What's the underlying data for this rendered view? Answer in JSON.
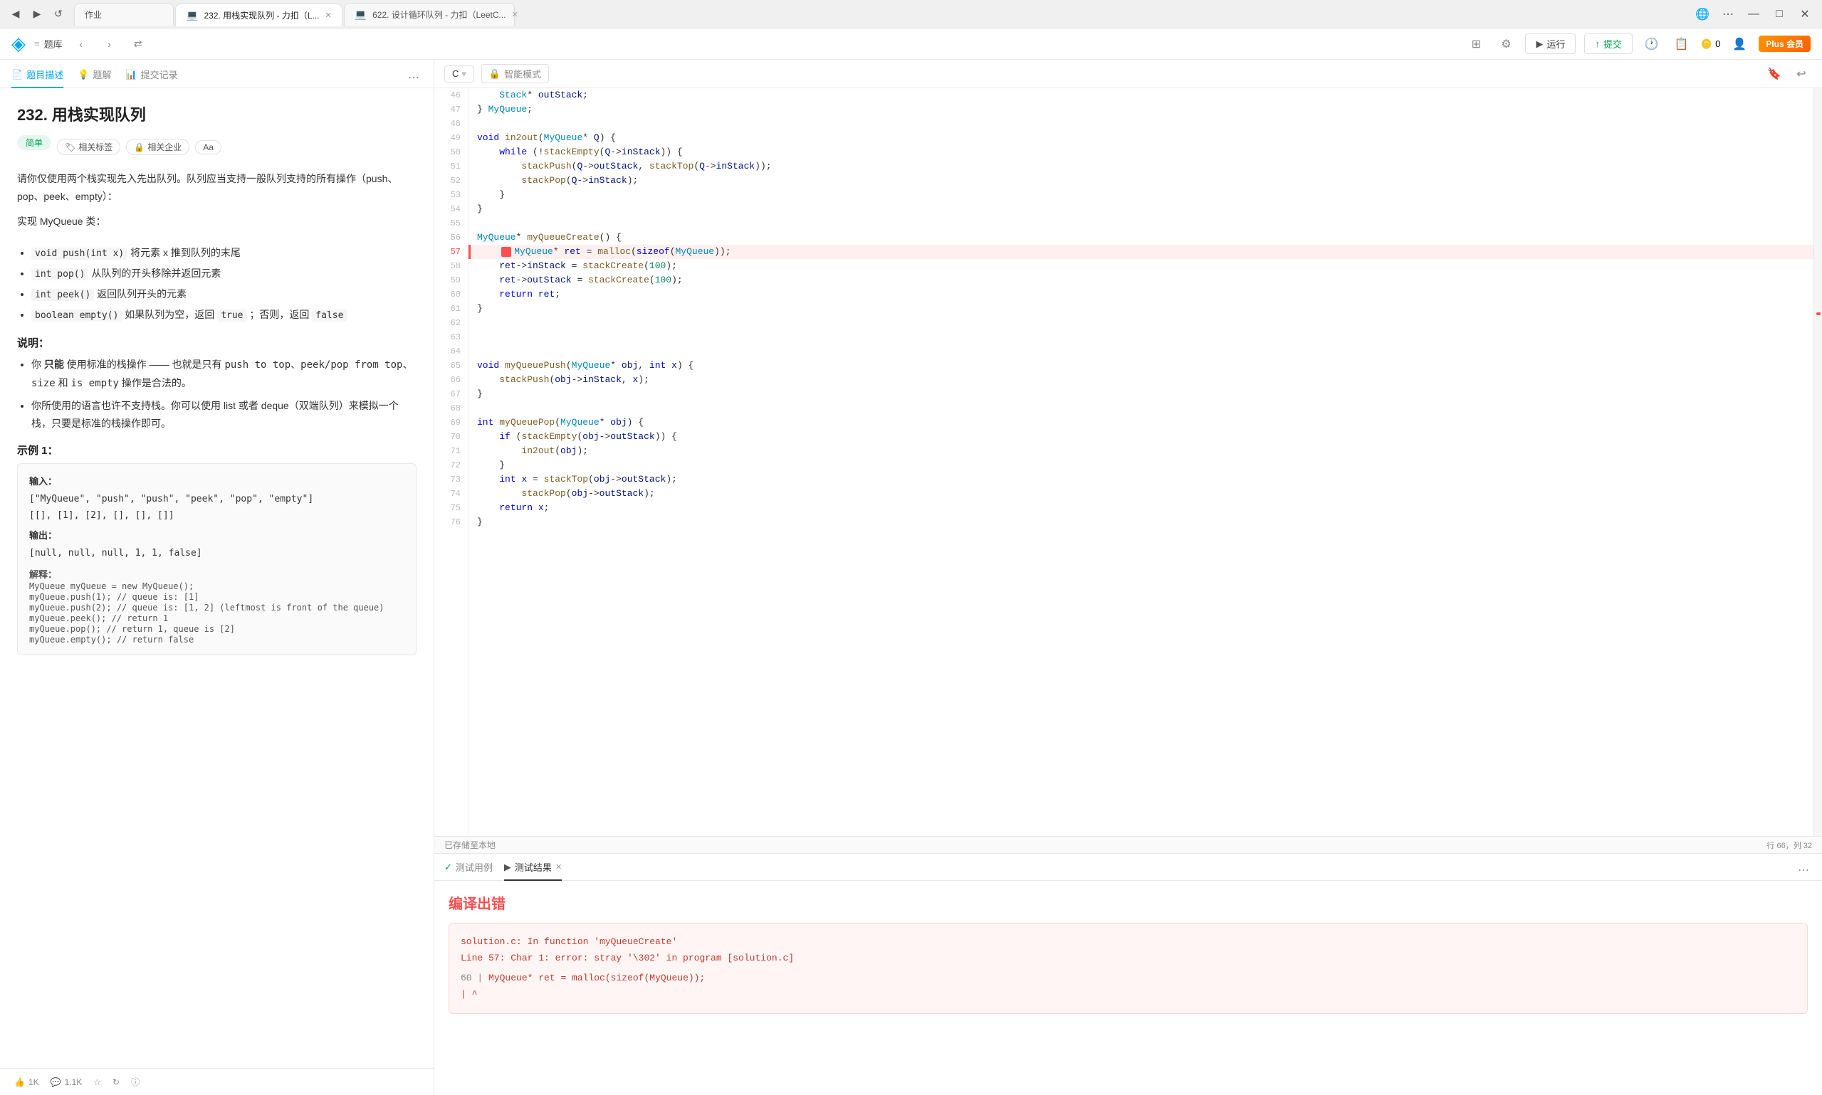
{
  "browser": {
    "tabs": [
      {
        "id": "tab1",
        "label": "作业",
        "icon": "📋",
        "active": false
      },
      {
        "id": "tab2",
        "label": "232. 用栈实现队列 - 力扣（L...",
        "icon": "💻",
        "active": true
      },
      {
        "id": "tab3",
        "label": "622. 设计循环队列 - 力扣（LeetC...",
        "icon": "💻",
        "active": false
      }
    ],
    "nav": {
      "back": "◀",
      "forward": "▶",
      "reload": "↺",
      "more": "⋯"
    }
  },
  "appbar": {
    "logo": "◈",
    "breadcrumb_home": "题库",
    "nav_prev": "‹",
    "nav_next": "›",
    "nav_random": "⇄",
    "run_label": "运行",
    "submit_label": "提交",
    "plus_label": "Plus 会员",
    "coin_count": "0",
    "save_label": "已存储至本地"
  },
  "left_panel": {
    "tabs": [
      {
        "id": "desc",
        "label": "题目描述",
        "icon": "📄",
        "active": true
      },
      {
        "id": "hint",
        "label": "题解",
        "icon": "💡",
        "active": false
      },
      {
        "id": "submit",
        "label": "提交记录",
        "icon": "📊",
        "active": false
      }
    ],
    "problem_number": "232.",
    "problem_title": "232. 用栈实现队列",
    "difficulty": "简单",
    "tags": [
      "相关标签",
      "相关企业",
      "Aa"
    ],
    "description": "请你仅使用两个栈实现先入先出队列。队列应当支持一般队列支持的所有操作（push、pop、peek、empty）：",
    "class_name": "实现 MyQueue 类：",
    "methods": [
      "void push(int x) 将元素 x 推到队列的末尾",
      "int pop() 从队列的开头移除并返回元素",
      "int peek() 返回队列开头的元素",
      "boolean empty() 如果队列为空，返回 true ；否则，返回 false"
    ],
    "notes_title": "说明：",
    "notes": [
      "你 只能 使用标准的栈操作 —— 也就是只有 push to top、peek/pop from top、size 和 is empty 操作是合法的。",
      "你所使用的语言也许不支持栈。你可以使用 list 或者 deque（双端队列）来模拟一个栈，只要是标准的栈操作即可。"
    ],
    "example_title": "示例 1：",
    "example_input_label": "输入：",
    "example_input1": "[\"MyQueue\", \"push\", \"push\", \"peek\", \"pop\", \"empty\"]",
    "example_input2": "[[], [1], [2], [], [], []]",
    "example_output_label": "输出：",
    "example_output": "[null, null, null, 1, 1, false]",
    "explanation_label": "解释：",
    "explanation_lines": [
      "MyQueue myQueue = new MyQueue();",
      "myQueue.push(1); // queue is: [1]",
      "myQueue.push(2); // queue is: [1, 2] (leftmost is front of the queue)",
      "myQueue.peek();  // return 1",
      "myQueue.pop();   // return 1, queue is [2]",
      "myQueue.empty(); // return false"
    ],
    "footer": {
      "likes": "1K",
      "comments": "1.1K",
      "bookmark": "☆",
      "refresh": "↻",
      "info": "ⓘ"
    }
  },
  "editor": {
    "language": "C",
    "ai_mode": "智能模式",
    "lines": [
      {
        "num": 46,
        "content": "    Stack* outStack;",
        "highlighted": false
      },
      {
        "num": 47,
        "content": "} MyQueue;",
        "highlighted": false
      },
      {
        "num": 48,
        "content": "",
        "highlighted": false
      },
      {
        "num": 49,
        "content": "void in2out(MyQueue* Q) {",
        "highlighted": false
      },
      {
        "num": 50,
        "content": "    while (!stackEmpty(Q->inStack)) {",
        "highlighted": false
      },
      {
        "num": 51,
        "content": "        stackPush(Q->outStack, stackTop(Q->inStack));",
        "highlighted": false
      },
      {
        "num": 52,
        "content": "        stackPop(Q->inStack);",
        "highlighted": false
      },
      {
        "num": 53,
        "content": "    }",
        "highlighted": false
      },
      {
        "num": 54,
        "content": "}",
        "highlighted": false
      },
      {
        "num": 55,
        "content": "",
        "highlighted": false
      },
      {
        "num": 56,
        "content": "MyQueue* myQueueCreate() {",
        "highlighted": false
      },
      {
        "num": 57,
        "content": "    MyQueue* ret = malloc(sizeof(MyQueue));",
        "highlighted": true
      },
      {
        "num": 58,
        "content": "    ret->inStack = stackCreate(100);",
        "highlighted": false
      },
      {
        "num": 59,
        "content": "    ret->outStack = stackCreate(100);",
        "highlighted": false
      },
      {
        "num": 60,
        "content": "    return ret;",
        "highlighted": false
      },
      {
        "num": 61,
        "content": "}",
        "highlighted": false
      },
      {
        "num": 62,
        "content": "",
        "highlighted": false
      },
      {
        "num": 63,
        "content": "",
        "highlighted": false
      },
      {
        "num": 64,
        "content": "",
        "highlighted": false
      },
      {
        "num": 65,
        "content": "void myQueuePush(MyQueue* obj, int x) {",
        "highlighted": false
      },
      {
        "num": 66,
        "content": "    stackPush(obj->inStack, x);",
        "highlighted": false
      },
      {
        "num": 67,
        "content": "}",
        "highlighted": false
      },
      {
        "num": 68,
        "content": "",
        "highlighted": false
      },
      {
        "num": 69,
        "content": "int myQueuePop(MyQueue* obj) {",
        "highlighted": false
      },
      {
        "num": 70,
        "content": "    if (stackEmpty(obj->outStack)) {",
        "highlighted": false
      },
      {
        "num": 71,
        "content": "        in2out(obj);",
        "highlighted": false
      },
      {
        "num": 72,
        "content": "    }",
        "highlighted": false
      },
      {
        "num": 73,
        "content": "    int x = stackTop(obj->outStack);",
        "highlighted": false
      },
      {
        "num": 74,
        "content": "        stackPop(obj->outStack);",
        "highlighted": false
      },
      {
        "num": 75,
        "content": "    return x;",
        "highlighted": false
      },
      {
        "num": 76,
        "content": "}",
        "highlighted": false
      }
    ],
    "status_left": "已存储至本地",
    "status_right": "行 66，列 32"
  },
  "test_panel": {
    "tabs": [
      {
        "id": "testcase",
        "label": "测试用例",
        "active": false,
        "icon": "✓"
      },
      {
        "id": "result",
        "label": "测试结果",
        "active": true,
        "icon": "▶",
        "closeable": true
      }
    ],
    "compile_error_title": "编译出错",
    "error_message": "solution.c: In function 'myQueueCreate'",
    "error_detail": "Line 57: Char 1: error: stray '\\302' in program [solution.c]",
    "error_line_num": "60 |",
    "error_line_code": "    MyQueue* ret = malloc(sizeof(MyQueue));",
    "error_caret": "    | ^"
  }
}
